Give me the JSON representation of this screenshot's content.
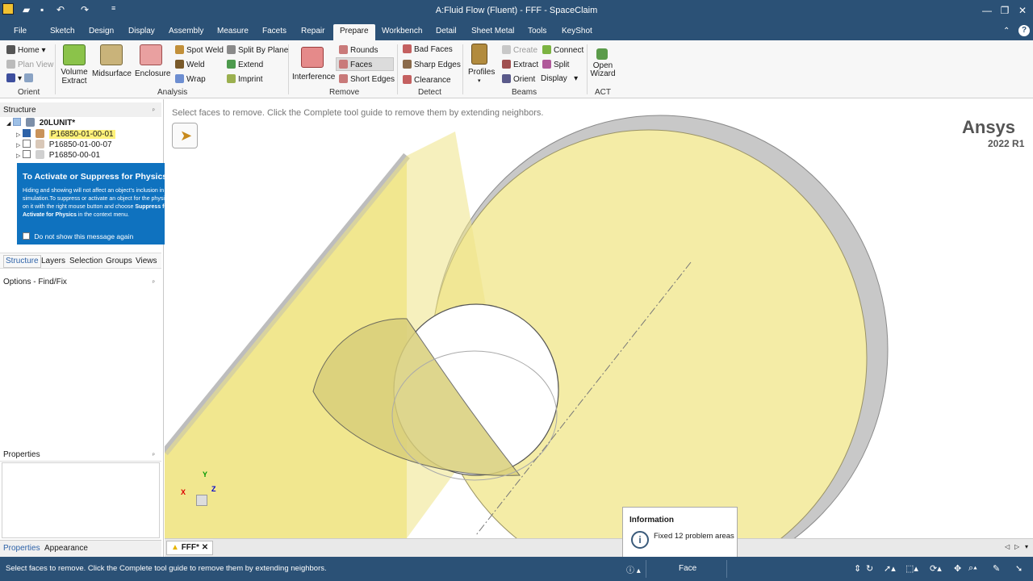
{
  "window": {
    "title": "A:Fluid Flow (Fluent) - FFF - SpaceClaim"
  },
  "menu": [
    "File",
    "Sketch",
    "Design",
    "Display",
    "Assembly",
    "Measure",
    "Facets",
    "Repair",
    "Prepare",
    "Workbench",
    "Detail",
    "Sheet Metal",
    "Tools",
    "KeyShot"
  ],
  "menu_active": "Prepare",
  "ribbon": {
    "orient": {
      "home": "Home",
      "plan_view": "Plan View",
      "group": "Orient"
    },
    "analysis": {
      "volume_extract": "Volume Extract",
      "midsurface": "Midsurface",
      "enclosure": "Enclosure",
      "spot_weld": "Spot Weld",
      "weld": "Weld",
      "wrap": "Wrap",
      "split_by_plane": "Split By Plane",
      "extend": "Extend",
      "imprint": "Imprint",
      "group": "Analysis"
    },
    "remove": {
      "interference": "Interference",
      "rounds": "Rounds",
      "faces": "Faces",
      "short_edges": "Short Edges",
      "group": "Remove"
    },
    "detect": {
      "bad_faces": "Bad Faces",
      "sharp_edges": "Sharp Edges",
      "clearance": "Clearance",
      "group": "Detect"
    },
    "beams": {
      "profiles": "Profiles",
      "create": "Create",
      "extract": "Extract",
      "orient": "Orient",
      "connect": "Connect",
      "split": "Split",
      "display": "Display",
      "group": "Beams"
    },
    "act": {
      "open_wizard": "Open Wizard",
      "group": "ACT"
    }
  },
  "structure": {
    "title": "Structure",
    "root": "20LUNIT*",
    "items": [
      {
        "label": "P16850-01-00-01",
        "checked": true,
        "selected": true
      },
      {
        "label": "P16850-01-00-07",
        "checked": false,
        "selected": false
      },
      {
        "label": "P16850-00-01",
        "checked": false,
        "selected": false
      }
    ],
    "tabs": [
      "Structure",
      "Layers",
      "Selection",
      "Groups",
      "Views"
    ],
    "options_title": "Options - Find/Fix",
    "properties_title": "Properties",
    "bottom_tabs": [
      "Properties",
      "Appearance"
    ]
  },
  "popup": {
    "title": "To Activate or Suppress for Physics",
    "body_1": "Hiding and showing will not affect an object's inclusion in the physics simulation.To suppress or activate an object for the physics simulation, click on it with the right mouse button and choose ",
    "bold_1": "Suppress for Physics",
    "body_2": " or ",
    "bold_2": "Activate  for Physics",
    "body_3": " in the context menu.",
    "checkbox": "Do not show this message again"
  },
  "viewport": {
    "hint": "Select faces to remove. Click the Complete tool guide to remove them by extending neighbors.",
    "logo": "Ansys",
    "version": "2022 R1",
    "axes": {
      "x": "X",
      "y": "Y",
      "z": "Z"
    }
  },
  "doc_tab": "FFF*",
  "info": {
    "title": "Information",
    "message": "Fixed 12 problem areas"
  },
  "status": {
    "message": "Select faces to remove. Click the Complete tool guide to remove them by extending neighbors.",
    "mode": "Face"
  },
  "colors": {
    "titlebar": "#2b5176",
    "face_yellow": "#f3ea9a",
    "selected_highlight": "#fff27a",
    "popup_blue": "#0f72bf"
  }
}
